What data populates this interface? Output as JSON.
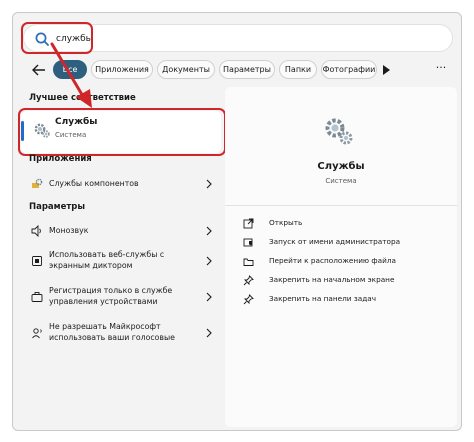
{
  "search": {
    "value": "службы",
    "placeholder": ""
  },
  "filters": {
    "chips": [
      "Все",
      "Приложения",
      "Документы",
      "Параметры",
      "Папки",
      "Фотографии"
    ]
  },
  "best_match": {
    "title": "Лучшее соответствие",
    "name": "Службы",
    "subtitle": "Система"
  },
  "apps": {
    "title": "Приложения",
    "items": [
      {
        "label": "Службы компонентов"
      }
    ]
  },
  "settings": {
    "title": "Параметры",
    "items": [
      {
        "line1": "Монозвук",
        "line2": ""
      },
      {
        "line1": "Использовать веб-службы с",
        "line2": "экранным диктором"
      },
      {
        "line1": "Регистрация только в службе",
        "line2": "управления устройствами"
      },
      {
        "line1": "Не разрешать Майкрософт",
        "line2": "использовать ваши голосовые"
      }
    ]
  },
  "detail": {
    "title": "Службы",
    "subtitle": "Система",
    "actions": [
      {
        "label": "Открыть",
        "icon": "open-external-icon"
      },
      {
        "label": "Запуск от имени администратора",
        "icon": "shield-admin-icon"
      },
      {
        "label": "Перейти к расположению файла",
        "icon": "folder-icon"
      },
      {
        "label": "Закрепить на начальном экране",
        "icon": "pin-icon"
      },
      {
        "label": "Закрепить на панели задач",
        "icon": "pin-icon"
      }
    ]
  },
  "colors": {
    "accent": "#2f5f7f",
    "highlight": "#d0262a",
    "focus": "#1c6ec9"
  }
}
